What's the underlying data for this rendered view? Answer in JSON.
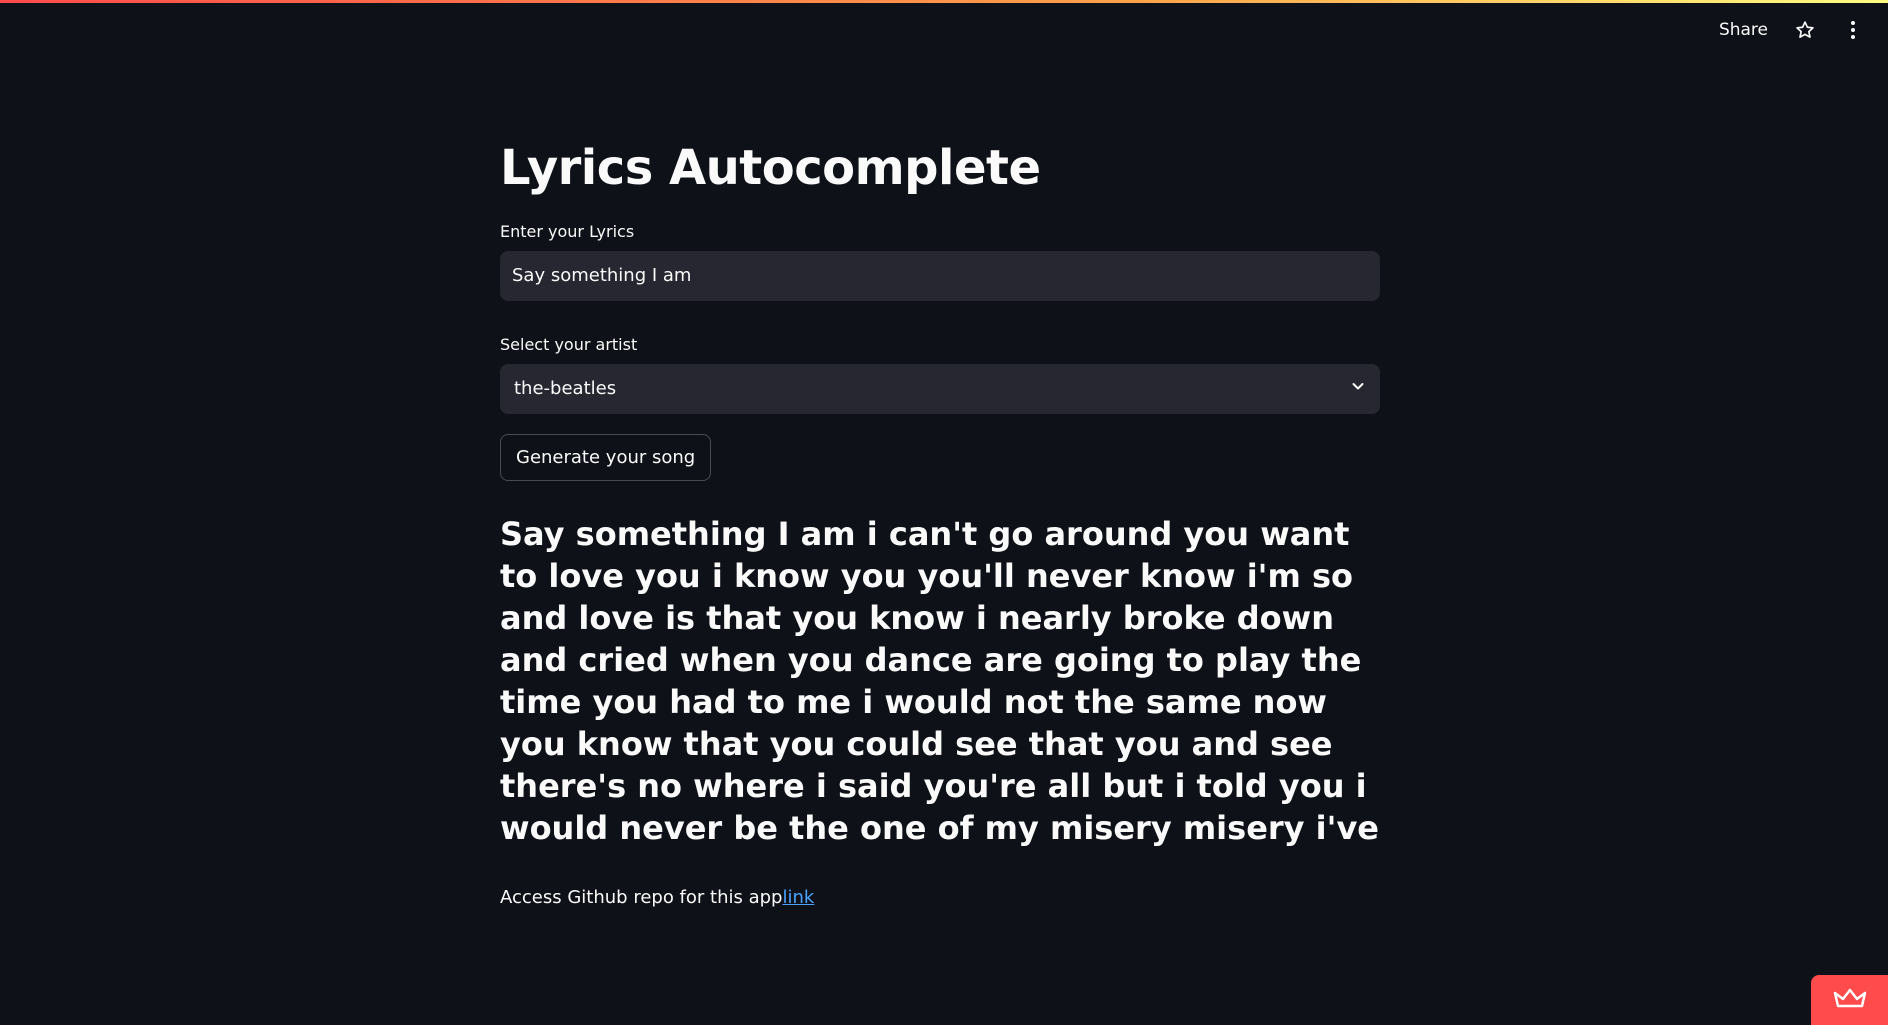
{
  "header": {
    "share_label": "Share",
    "star_icon": "star-icon",
    "menu_icon": "kebab-menu-icon"
  },
  "main": {
    "title": "Lyrics Autocomplete",
    "lyrics_input": {
      "label": "Enter your Lyrics",
      "value": "Say something I am"
    },
    "artist_select": {
      "label": "Select your artist",
      "selected": "the-beatles",
      "icon": "chevron-down-icon"
    },
    "generate_button_label": "Generate your song",
    "generated_lyrics": "Say something I am i can't go around you want to love you i know you you'll never know i'm so and love is that you know i nearly broke down and cried when you dance are going to play the time you had to me i would not the same now you know that you could see that you and see there's no where i said you're all but i told you i would never be the one of my misery misery i've",
    "footer_text": "Access Github repo for this app",
    "footer_link": "link"
  },
  "badge_icon": "crown-icon",
  "colors": {
    "background": "#0e1117",
    "input_bg": "#262730",
    "accent": "#ff4b4b",
    "link": "#4aa3ff"
  }
}
